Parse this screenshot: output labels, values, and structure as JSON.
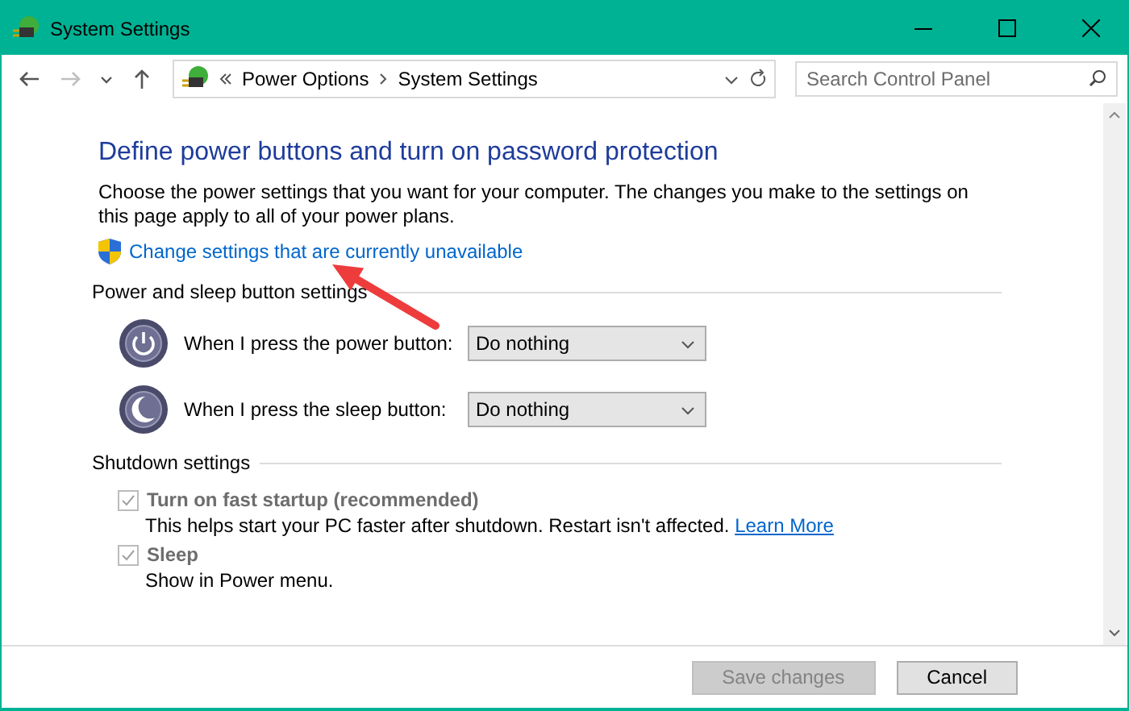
{
  "window": {
    "title": "System Settings"
  },
  "nav": [
    {
      "kind": "back",
      "disabled": false
    },
    {
      "kind": "forward",
      "disabled": true
    },
    {
      "kind": "recent",
      "disabled": false
    },
    {
      "kind": "up",
      "disabled": false
    }
  ],
  "address": {
    "crumbs": [
      "Power Options",
      "System Settings"
    ]
  },
  "search": {
    "placeholder": "Search Control Panel"
  },
  "heading": "Define power buttons and turn on password protection",
  "description": "Choose the power settings that you want for your computer. The changes you make to the settings on this page apply to all of your power plans.",
  "admin_link": "Change settings that are currently unavailable",
  "sections": [
    {
      "kind": "selects",
      "title": "Power and sleep button settings",
      "rows": [
        {
          "kind": "power",
          "label": "When I press the power button:",
          "value": "Do nothing"
        },
        {
          "kind": "sleep",
          "label": "When I press the sleep button:",
          "value": "Do nothing"
        }
      ]
    },
    {
      "kind": "checkboxes",
      "title": "Shutdown settings",
      "rows": [
        {
          "label": "Turn on fast startup (recommended)",
          "checked": true,
          "disabled": true,
          "description": "This helps start your PC faster after shutdown. Restart isn't affected.",
          "link": "Learn More"
        },
        {
          "label": "Sleep",
          "checked": true,
          "disabled": true,
          "description": "Show in Power menu."
        }
      ]
    }
  ],
  "buttons": [
    {
      "label": "Save changes",
      "disabled": true
    },
    {
      "label": "Cancel",
      "disabled": false
    }
  ]
}
